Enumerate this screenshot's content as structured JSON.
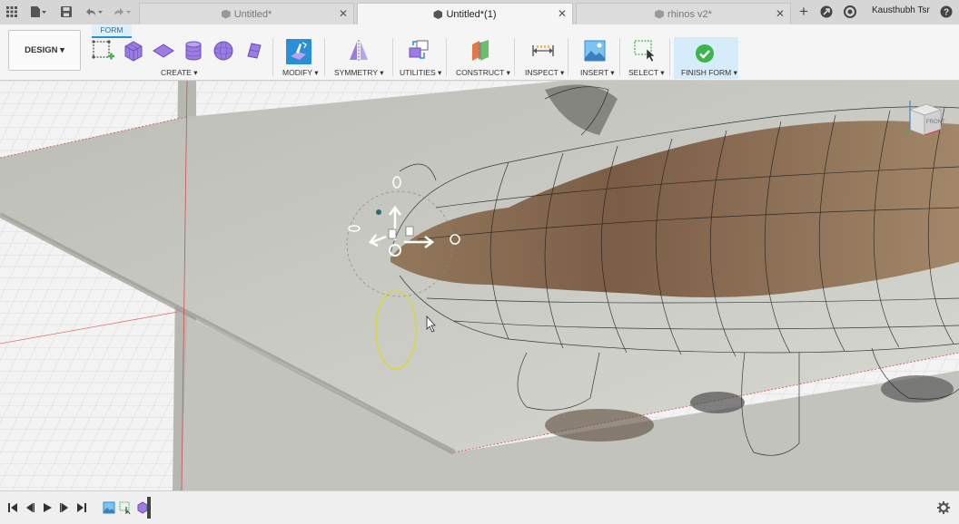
{
  "tabs": [
    {
      "label": "Untitled*",
      "active": false
    },
    {
      "label": "Untitled*(1)",
      "active": true
    },
    {
      "label": "rhinos v2*",
      "active": false
    }
  ],
  "user": {
    "name": "Kausthubh Tsr"
  },
  "workspace": {
    "label": "DESIGN ▾"
  },
  "toolbar": {
    "active_tab": "FORM",
    "groups": {
      "create": "CREATE ▾",
      "modify": "MODIFY ▾",
      "symmetry": "SYMMETRY ▾",
      "utilities": "UTILITIES ▾",
      "construct": "CONSTRUCT ▾",
      "inspect": "INSPECT ▾",
      "insert": "INSERT ▾",
      "select": "SELECT ▾",
      "finish_form": "FINISH FORM ▾"
    }
  },
  "viewcube": {
    "face": "FRONT"
  },
  "colors": {
    "accent": "#2a8fd6",
    "finish_green": "#3cb54a",
    "form_purple": "#8f6fd6",
    "ring_yellow": "#d8d83a"
  }
}
